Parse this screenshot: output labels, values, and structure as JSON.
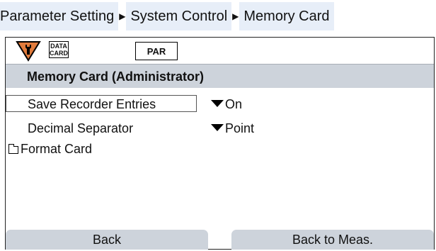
{
  "breadcrumb": {
    "items": [
      "Parameter Setting",
      "System Control",
      "Memory Card"
    ],
    "separator_icon": "triangle-right-icon"
  },
  "status": {
    "maintenance_icon": "wrench-warning-icon",
    "datacard_label_line1": "DATA",
    "datacard_label_line2": "CARD",
    "mode_label": "PAR",
    "colors": {
      "warning_orange": "#e07b3c",
      "band_gray": "#cdd3db",
      "crumb_highlight": "#e7eef8"
    }
  },
  "header": {
    "title": "Memory Card (Administrator)"
  },
  "menu": {
    "items": [
      {
        "label": "Save Recorder Entries",
        "value": "On",
        "selected": true
      },
      {
        "label": "Decimal Separator",
        "value": "Point",
        "selected": false
      },
      {
        "label": "Format Card",
        "icon": "folder-icon"
      }
    ]
  },
  "softkeys": {
    "left": "Back",
    "right": "Back to Meas."
  }
}
